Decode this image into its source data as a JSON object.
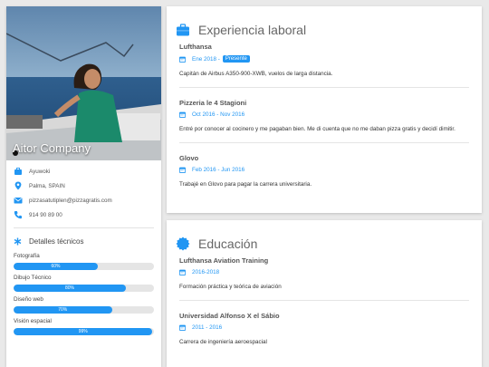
{
  "profile": {
    "name": "Aitor Company",
    "job": "Ayuwoki",
    "location": "Palma, SPAIN",
    "email": "pizzasatutiplen@pizzagratis.com",
    "phone": "914 90 89 00"
  },
  "skills": {
    "title": "Detalles técnicos",
    "items": [
      {
        "label": "Fotografía",
        "value": "60%",
        "percent": 60
      },
      {
        "label": "Dibujo Técnico",
        "value": "80%",
        "percent": 80
      },
      {
        "label": "Diseño web",
        "value": "70%",
        "percent": 70
      },
      {
        "label": "Visión espacial",
        "value": "99%",
        "percent": 99
      }
    ]
  },
  "experience": {
    "title": "Experiencia laboral",
    "entries": [
      {
        "company": "Lufthansa",
        "date": "Ene 2018 -",
        "badge": "Presente",
        "desc": "Capitán de Airbus A350-900-XWB, vuelos de larga distancia."
      },
      {
        "company": "Pizzeria le 4 Stagioni",
        "date": "Oct 2016 - Nov 2016",
        "desc": "Entré por conocer al cocinero y me pagaban bien. Me di cuenta que no me daban pizza gratis y decidí dimitir."
      },
      {
        "company": "Glovo",
        "date": "Feb 2016 - Jun 2016",
        "desc": "Trabajé en Glovo para pagar la carrera universitaria."
      }
    ]
  },
  "education": {
    "title": "Educación",
    "entries": [
      {
        "school": "Lufthansa Aviation Training",
        "date": "2016-2018",
        "desc": "Formación práctica y teórica de aviación"
      },
      {
        "school": "Universidad Alfonso X el Sábio",
        "date": "2011 - 2016",
        "desc": "Carrera de ingeniería aeroespacial"
      }
    ]
  },
  "colors": {
    "accent": "#2196f3",
    "background": "#e9e9e9"
  },
  "icons": [
    "briefcase-icon",
    "map-marker-icon",
    "envelope-icon",
    "phone-icon",
    "asterisk-icon",
    "calendar-icon",
    "certificate-icon"
  ]
}
